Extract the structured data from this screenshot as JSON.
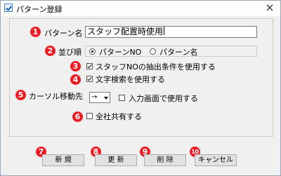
{
  "window": {
    "title": "パターン登録",
    "close_glyph": "×"
  },
  "markers": [
    "1",
    "2",
    "3",
    "4",
    "5",
    "6",
    "7",
    "8",
    "9",
    "10"
  ],
  "pattern_name": {
    "label": "パターン名",
    "value": "スタッフ配置時使用"
  },
  "sort_order": {
    "label": "並び順",
    "options": [
      {
        "label": "パターンNO",
        "selected": true
      },
      {
        "label": "パターン名",
        "selected": false
      }
    ]
  },
  "options": {
    "staff_no_extract": {
      "label": "スタッフNOの抽出条件を使用する",
      "checked": true
    },
    "text_search": {
      "label": "文字検索を使用する",
      "checked": true
    },
    "shared_all": {
      "label": "全社共有する",
      "checked": false
    }
  },
  "cursor_move": {
    "label": "カーソル移動先",
    "selected": "→",
    "input_screen_label": "入力画面で使用する",
    "input_screen_checked": false
  },
  "buttons": {
    "new": "新 規",
    "update": "更 新",
    "delete": "削 除",
    "cancel": "キャンセル"
  },
  "colors": {
    "marker": "#ed1c24",
    "button_face": "#e1e1e1",
    "window_bg": "#f0f0f0"
  }
}
